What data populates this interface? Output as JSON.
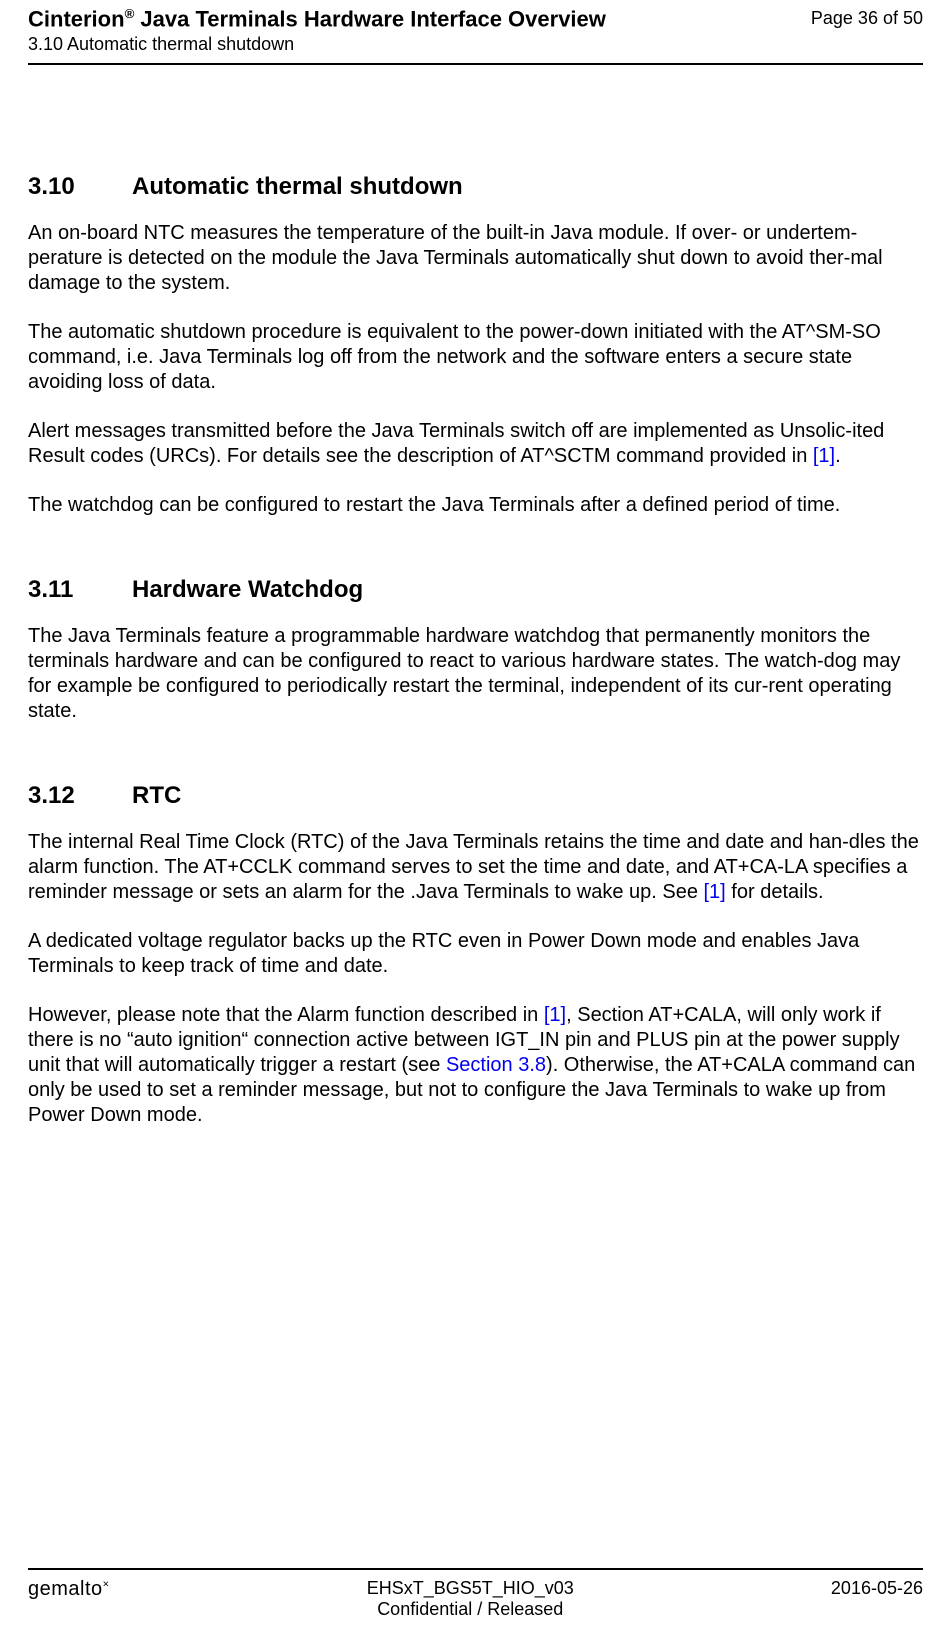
{
  "header": {
    "title_prefix": "Cinterion",
    "title_reg": "®",
    "title_rest": " Java Terminals Hardware Interface Overview",
    "subtitle": "3.10 Automatic thermal shutdown",
    "page": "Page 36 of 50"
  },
  "sections": {
    "s310": {
      "num": "3.10",
      "title": "Automatic thermal shutdown"
    },
    "s311": {
      "num": "3.11",
      "title": "Hardware Watchdog"
    },
    "s312": {
      "num": "3.12",
      "title": "RTC"
    }
  },
  "p1": "An on-board NTC measures the temperature of the built-in Java module. If over- or undertem-perature is detected on the module the Java Terminals automatically shut down to avoid ther-mal damage to the system.",
  "p2": "The automatic shutdown procedure is equivalent to the power-down initiated with the AT^SM-SO command, i.e. Java Terminals log off from the network and the software enters a secure state avoiding loss of data.",
  "p3a": "Alert messages transmitted before the Java Terminals switch off are implemented as Unsolic-ited Result codes (URCs). For details see the description of AT^SCTM command provided in ",
  "ref1": "[1]",
  "p3b": ".",
  "p4": "The watchdog can be configured to restart the Java Terminals after a defined period of time.",
  "p5": "The Java Terminals feature a programmable hardware watchdog that permanently monitors the terminals hardware and can be configured to react to various hardware states. The watch-dog may for example be configured to periodically restart the terminal, independent of its cur-rent operating state.",
  "p6a": "The internal Real Time Clock (RTC) of the Java Terminals retains the time and date and han-dles the alarm function. The AT+CCLK command serves to set the time and date, and AT+CA-LA specifies a reminder message or sets an alarm for the .Java Terminals to wake up. See ",
  "ref2": "[1]",
  "p6b": " for details.",
  "p7": "A dedicated voltage regulator backs up the RTC even in Power Down mode and enables Java Terminals to keep track of time and date.",
  "p8a": "However, please note that the Alarm function described in ",
  "ref3": "[1]",
  "p8b": ", Section AT+CALA, will only work if there is no “auto ignition“ connection active between IGT_IN pin and PLUS pin at the power supply unit that will automatically trigger a restart (see ",
  "ref4": "Section 3.8",
  "p8c": "). Otherwise, the AT+CALA command can only be used to set a reminder message, but not to configure the Java Terminals to wake up from Power Down mode.",
  "footer": {
    "logo": "gemalto",
    "logo_star": "×",
    "doc_id": "EHSxT_BGS5T_HIO_v03",
    "conf": "Confidential / Released",
    "date": "2016-05-26"
  }
}
